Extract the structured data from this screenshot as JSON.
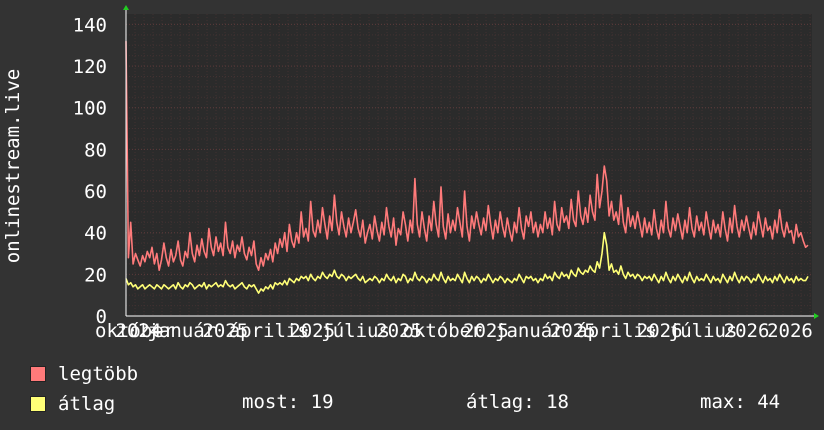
{
  "chart_data": {
    "type": "line",
    "ylabel": "onlinestream.live",
    "ylim": [
      0,
      145
    ],
    "yticks": [
      0,
      20,
      40,
      60,
      80,
      100,
      120,
      140
    ],
    "xticks": [
      "október",
      "2024",
      "január",
      "2025",
      "április",
      "2025",
      "július",
      "2025",
      "október",
      "2025",
      "január",
      "2025",
      "április",
      "2026",
      "július",
      "2026",
      "2026"
    ],
    "grid": true,
    "colors": {
      "background": "#333333",
      "plot": "#2b2b2b",
      "grid_major": "#5a3a3a",
      "grid_minor": "#423232",
      "max_series": "#ff7a7a",
      "avg_series": "#ffff77",
      "axis": "#ffffff",
      "arrow": "#22cc22"
    },
    "series": [
      {
        "name": "legtöbb",
        "color": "#ff7a7a",
        "values": [
          132,
          28,
          45,
          25,
          30,
          27,
          24,
          29,
          26,
          31,
          28,
          33,
          25,
          30,
          22,
          27,
          35,
          28,
          24,
          32,
          26,
          29,
          36,
          27,
          24,
          31,
          28,
          40,
          30,
          26,
          34,
          29,
          37,
          31,
          28,
          42,
          33,
          29,
          38,
          31,
          35,
          29,
          45,
          33,
          30,
          36,
          28,
          34,
          31,
          38,
          30,
          27,
          33,
          29,
          36,
          25,
          22,
          28,
          24,
          30,
          27,
          32,
          26,
          35,
          30,
          37,
          33,
          40,
          31,
          44,
          36,
          33,
          40,
          35,
          50,
          38,
          42,
          36,
          55,
          41,
          38,
          46,
          40,
          52,
          44,
          37,
          48,
          41,
          58,
          45,
          39,
          50,
          43,
          38,
          47,
          40,
          45,
          51,
          42,
          38,
          46,
          35,
          40,
          44,
          37,
          48,
          41,
          36,
          45,
          39,
          52,
          43,
          38,
          47,
          34,
          42,
          39,
          50,
          44,
          36,
          46,
          40,
          66,
          44,
          38,
          50,
          42,
          36,
          48,
          41,
          55,
          44,
          38,
          62,
          43,
          37,
          49,
          40,
          46,
          41,
          52,
          45,
          38,
          60,
          43,
          36,
          48,
          42,
          50,
          44,
          39,
          47,
          41,
          53,
          44,
          37,
          46,
          40,
          50,
          43,
          38,
          47,
          41,
          36,
          45,
          40,
          52,
          42,
          37,
          48,
          43,
          50,
          40,
          45,
          38,
          44,
          40,
          50,
          42,
          47,
          39,
          55,
          44,
          41,
          52,
          45,
          48,
          42,
          56,
          46,
          43,
          60,
          48,
          44,
          52,
          45,
          58,
          50,
          46,
          68,
          52,
          60,
          72,
          65,
          48,
          55,
          46,
          50,
          44,
          58,
          45,
          40,
          52,
          43,
          48,
          42,
          50,
          44,
          38,
          47,
          40,
          45,
          39,
          51,
          42,
          37,
          46,
          40,
          55,
          42,
          38,
          47,
          41,
          49,
          43,
          37,
          46,
          40,
          52,
          42,
          38,
          48,
          41,
          45,
          39,
          50,
          43,
          37,
          46,
          40,
          44,
          38,
          50,
          42,
          36,
          47,
          40,
          53,
          43,
          38,
          46,
          41,
          48,
          42,
          37,
          45,
          39,
          50,
          44,
          38,
          47,
          41,
          43,
          37,
          46,
          40,
          51,
          42,
          38,
          45,
          40,
          41,
          35,
          44,
          38,
          40,
          36,
          33,
          34
        ]
      },
      {
        "name": "átlag",
        "color": "#ffff77",
        "values": [
          18,
          15,
          16,
          14,
          15,
          13,
          14,
          15,
          13,
          14,
          15,
          14,
          13,
          15,
          14,
          13,
          15,
          14,
          13,
          14,
          15,
          13,
          16,
          14,
          13,
          15,
          14,
          16,
          15,
          13,
          14,
          15,
          14,
          16,
          13,
          15,
          14,
          15,
          16,
          14,
          15,
          14,
          17,
          15,
          14,
          15,
          13,
          14,
          15,
          16,
          14,
          13,
          15,
          14,
          15,
          13,
          11,
          13,
          12,
          14,
          13,
          15,
          13,
          16,
          15,
          16,
          15,
          17,
          15,
          18,
          17,
          16,
          18,
          17,
          19,
          18,
          19,
          17,
          20,
          18,
          17,
          19,
          18,
          21,
          19,
          18,
          20,
          19,
          22,
          19,
          18,
          20,
          19,
          17,
          19,
          18,
          19,
          20,
          18,
          17,
          19,
          16,
          17,
          18,
          17,
          19,
          18,
          16,
          18,
          17,
          20,
          18,
          17,
          19,
          16,
          18,
          17,
          20,
          19,
          16,
          18,
          17,
          21,
          18,
          17,
          19,
          18,
          16,
          18,
          17,
          20,
          18,
          17,
          21,
          18,
          16,
          19,
          17,
          18,
          17,
          20,
          18,
          16,
          21,
          18,
          16,
          19,
          17,
          19,
          18,
          16,
          18,
          17,
          20,
          18,
          16,
          18,
          17,
          19,
          18,
          16,
          18,
          17,
          16,
          18,
          17,
          20,
          18,
          16,
          19,
          18,
          19,
          17,
          18,
          16,
          18,
          17,
          20,
          18,
          19,
          17,
          21,
          19,
          18,
          21,
          19,
          20,
          18,
          22,
          20,
          19,
          23,
          21,
          20,
          22,
          21,
          24,
          22,
          21,
          26,
          23,
          30,
          40,
          34,
          22,
          25,
          21,
          22,
          20,
          24,
          20,
          18,
          21,
          19,
          20,
          18,
          20,
          19,
          17,
          19,
          18,
          19,
          17,
          20,
          18,
          16,
          19,
          17,
          21,
          18,
          16,
          19,
          17,
          20,
          18,
          16,
          19,
          17,
          21,
          18,
          16,
          19,
          17,
          18,
          17,
          20,
          18,
          16,
          19,
          17,
          18,
          16,
          20,
          18,
          16,
          19,
          17,
          21,
          18,
          16,
          19,
          17,
          19,
          18,
          16,
          18,
          17,
          20,
          18,
          16,
          19,
          17,
          18,
          16,
          19,
          17,
          20,
          18,
          16,
          19,
          17,
          18,
          16,
          19,
          17,
          18,
          17,
          17,
          19
        ]
      }
    ]
  },
  "legend": {
    "max_label": "legtöbb",
    "avg_label": "átlag"
  },
  "stats": {
    "now": "most: 19",
    "avg": "átlag: 18",
    "max": "max: 44"
  }
}
